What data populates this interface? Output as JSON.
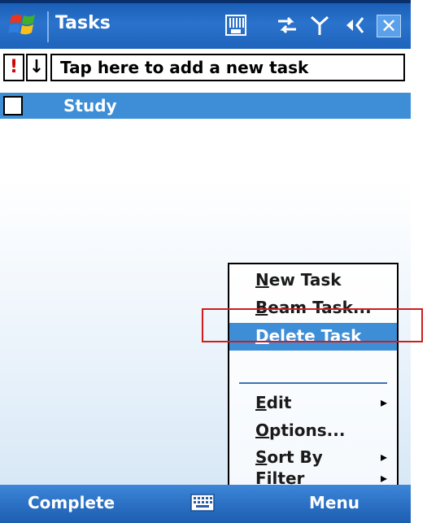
{
  "title_bar": {
    "title": "Tasks",
    "icons": [
      "windows-start-icon",
      "sim-card-icon",
      "connectivity-icon",
      "signal-icon",
      "volume-icon",
      "close-icon"
    ],
    "close_glyph": "✕"
  },
  "task_list": {
    "priority_column_glyph": "!",
    "sort_column_glyph": "↓",
    "new_task_placeholder": "Tap here to add a new task",
    "tasks": [
      {
        "name": "Study",
        "completed": false,
        "selected": true
      }
    ]
  },
  "context_menu": {
    "items": [
      {
        "label": "New Task",
        "mnemonic": "N",
        "rest": "ew Task",
        "submenu": false,
        "selected": false
      },
      {
        "label": "Beam Task...",
        "mnemonic": "B",
        "rest": "eam Task...",
        "submenu": false,
        "selected": false
      },
      {
        "label": "Delete Task",
        "mnemonic": "D",
        "rest": "elete Task",
        "submenu": false,
        "selected": true
      },
      {
        "label": "Edit",
        "mnemonic": "E",
        "rest": "dit",
        "submenu": true,
        "selected": false
      },
      {
        "label": "Options...",
        "mnemonic": "O",
        "rest": "ptions...",
        "submenu": false,
        "selected": false
      },
      {
        "label": "Sort By",
        "mnemonic": "S",
        "rest": "ort By",
        "submenu": true,
        "selected": false
      },
      {
        "label": "Filter",
        "mnemonic": "F",
        "rest": "ilter",
        "submenu": true,
        "selected": false
      }
    ],
    "submenu_arrow": "▸"
  },
  "softkeys": {
    "left": "Complete",
    "right": "Menu",
    "center_icon": "keyboard-icon"
  },
  "colors": {
    "title_bar": "#1e63bc",
    "selection": "#3d8ed6",
    "annotation": "#d01c1c",
    "priority_mark": "#d10000"
  }
}
